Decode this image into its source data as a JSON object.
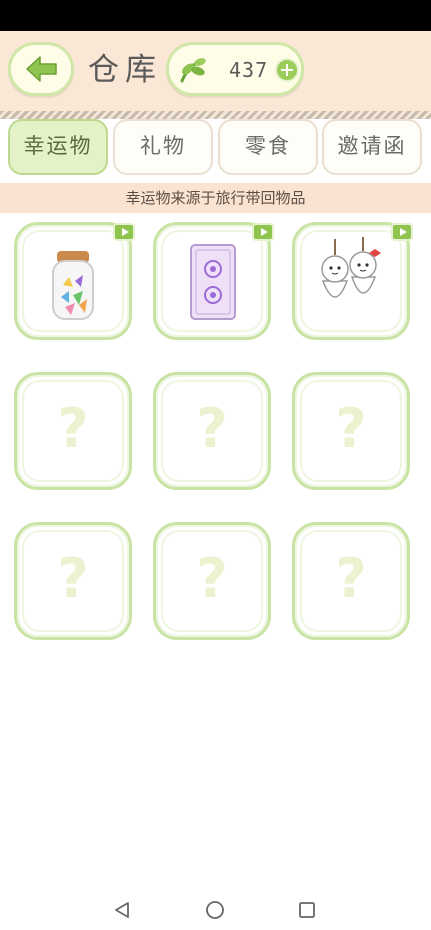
{
  "header": {
    "title": "仓库",
    "currency_count": "437"
  },
  "tabs": [
    {
      "label": "幸运物",
      "active": true
    },
    {
      "label": "礼物",
      "active": false
    },
    {
      "label": "零食",
      "active": false
    },
    {
      "label": "邀请函",
      "active": false
    }
  ],
  "notice": "幸运物来源于旅行带回物品",
  "slots": [
    {
      "item": "star-jar-icon",
      "locked": false,
      "badge": "video-icon"
    },
    {
      "item": "tarot-card-icon",
      "locked": false,
      "badge": "video-icon"
    },
    {
      "item": "teru-teru-bozu-icon",
      "locked": false,
      "badge": "video-icon"
    },
    {
      "placeholder": "?",
      "locked": true
    },
    {
      "placeholder": "?",
      "locked": true
    },
    {
      "placeholder": "?",
      "locked": true
    },
    {
      "placeholder": "?",
      "locked": true
    },
    {
      "placeholder": "?",
      "locked": true
    },
    {
      "placeholder": "?",
      "locked": true
    }
  ],
  "colors": {
    "header_bg": "#fbe7d6",
    "accent_green": "#9ccc5a",
    "slot_border": "#c8e3a3",
    "active_tab_bg": "#e4f3c7"
  }
}
